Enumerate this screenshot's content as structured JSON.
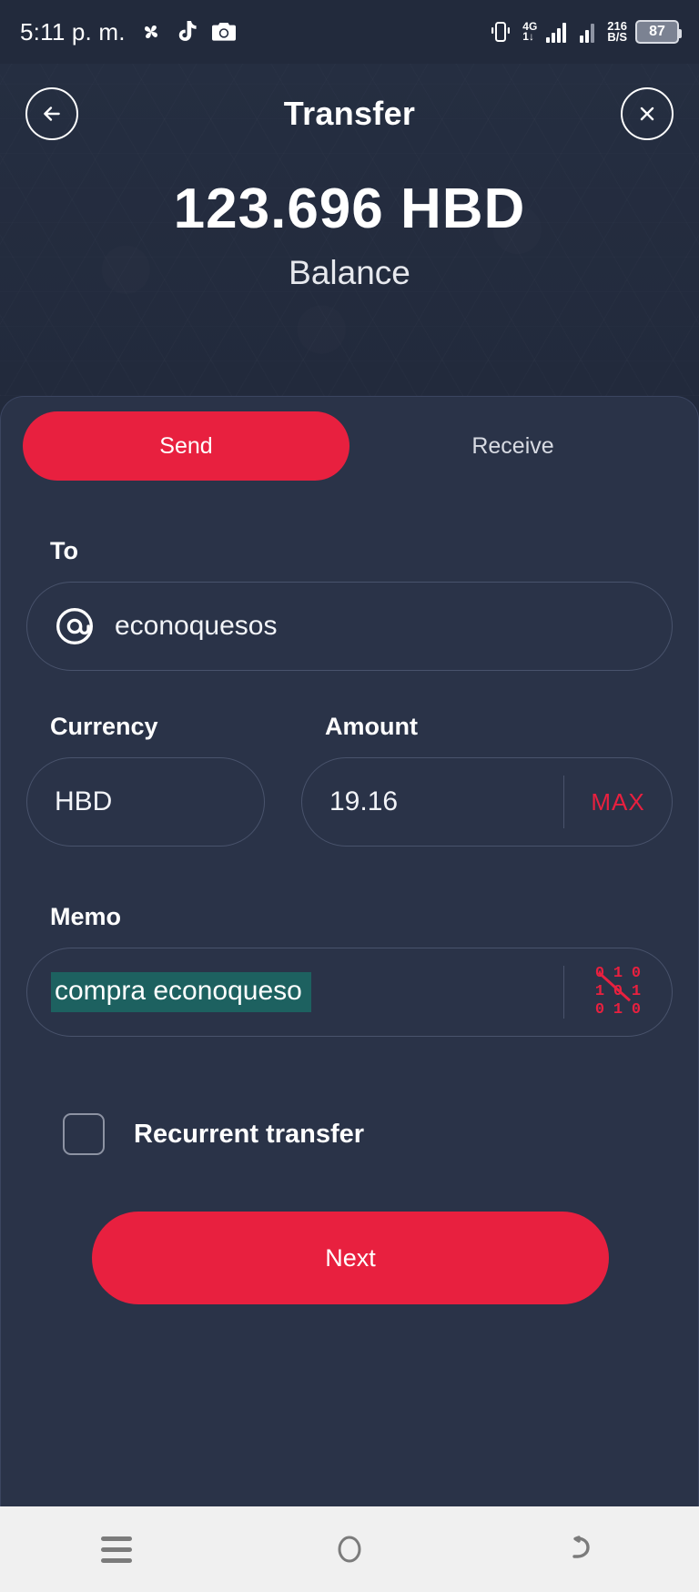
{
  "status_bar": {
    "time": "5:11 p. m.",
    "app_icons": [
      "pinwheel-icon",
      "tiktok-icon",
      "camera-icon"
    ],
    "network_type": "4G",
    "network_sub": "1↓",
    "data_rate_value": "216",
    "data_rate_unit": "B/S",
    "battery_percent": "87"
  },
  "header": {
    "back_icon": "arrow-left-icon",
    "title": "Transfer",
    "close_icon": "close-icon",
    "balance_amount": "123.696  HBD",
    "balance_label": "Balance"
  },
  "tabs": [
    {
      "label": "Send",
      "active": true
    },
    {
      "label": "Receive",
      "active": false
    }
  ],
  "form": {
    "to": {
      "label": "To",
      "icon": "at-sign-icon",
      "value": "econoquesos",
      "placeholder": "Username"
    },
    "currency": {
      "label": "Currency",
      "value": "HBD"
    },
    "amount": {
      "label": "Amount",
      "value": "19.16",
      "placeholder": "0.000",
      "max_label": "MAX"
    },
    "memo": {
      "label": "Memo",
      "value": "compra econoqueso",
      "placeholder": "Memo",
      "selected": true,
      "encrypt_icon": "binary-encrypt-icon",
      "encrypt_digits": [
        "0",
        "1",
        "0",
        "1",
        "0",
        "1",
        "0",
        "1",
        "0"
      ]
    },
    "recurrent": {
      "label": "Recurrent transfer",
      "checked": false
    }
  },
  "primary_action": {
    "label": "Next"
  },
  "nav_bar": {
    "recents_icon": "recents-icon",
    "home_icon": "home-circle-icon",
    "back_icon": "back-arrow-icon"
  },
  "colors": {
    "page_background": "#222a3c",
    "card_background": "#2a3348",
    "accent_red": "#e8203f",
    "selection_teal": "#1d6160",
    "border": "#49536c",
    "text_primary": "#ffffff",
    "nav_bar": "#f0f0f0"
  }
}
